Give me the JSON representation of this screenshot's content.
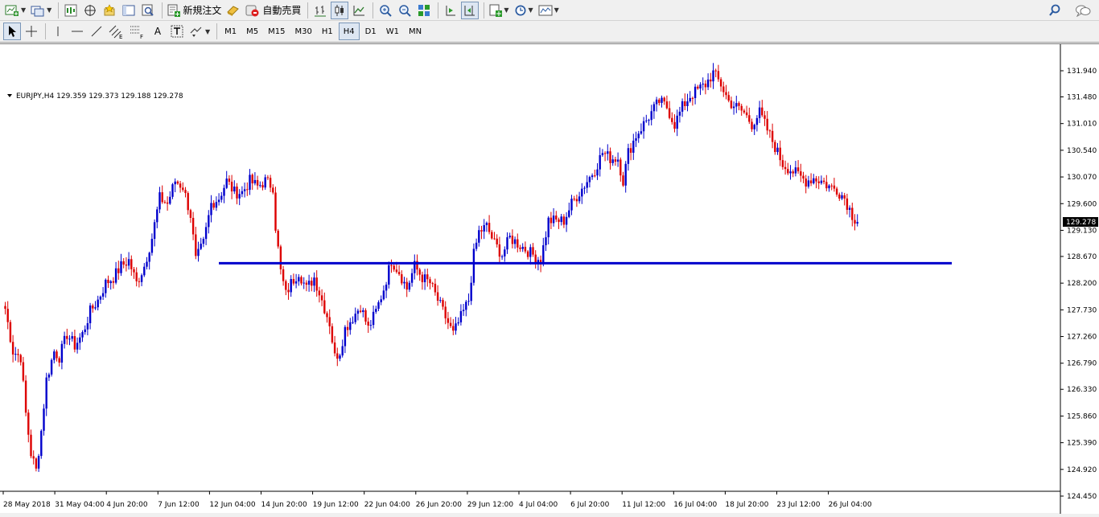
{
  "toolbar_main": {
    "new_order_label": "新規注文",
    "auto_trade_label": "自動売買",
    "icons": [
      "new-chart-icon",
      "profiles-icon",
      "market-watch-icon",
      "navigator-icon",
      "favorites-icon",
      "data-window-icon",
      "strategy-tester-icon",
      "new-order-icon",
      "metaeditor-icon",
      "autotrading-icon",
      "bar-chart-icon",
      "candlestick-icon",
      "line-chart-icon",
      "zoom-in-icon",
      "zoom-out-icon",
      "tile-windows-icon",
      "autoscroll-icon",
      "chart-shift-icon",
      "indicators-icon",
      "periods-icon",
      "templates-icon",
      "search-icon",
      "chat-icon"
    ]
  },
  "toolbar_draw": {
    "fib_e_label": "E",
    "fib_f_label": "F",
    "text_label": "A",
    "timeframes": [
      "M1",
      "M5",
      "M15",
      "M30",
      "H1",
      "H4",
      "D1",
      "W1",
      "MN"
    ],
    "active_timeframe": "H4"
  },
  "chart": {
    "header": "EURJPY,H4  129.359 129.373 129.188 129.278",
    "current_price": "129.278",
    "price_labels": [
      "131.940",
      "131.480",
      "131.010",
      "130.540",
      "130.070",
      "129.600",
      "129.130",
      "128.670",
      "128.200",
      "127.730",
      "127.260",
      "126.790",
      "126.330",
      "125.860",
      "125.390",
      "124.920",
      "124.450"
    ],
    "time_labels": [
      "28 May 2018",
      "31 May 04:00",
      "4 Jun 20:00",
      "7 Jun 12:00",
      "12 Jun 04:00",
      "14 Jun 20:00",
      "19 Jun 12:00",
      "22 Jun 04:00",
      "26 Jun 20:00",
      "29 Jun 12:00",
      "4 Jul 04:00",
      "6 Jul 20:00",
      "11 Jul 12:00",
      "16 Jul 04:00",
      "18 Jul 20:00",
      "23 Jul 12:00",
      "26 Jul 04:00"
    ],
    "horizontal_line_price": 128.55,
    "colors": {
      "bull": "#0000cc",
      "bear": "#dd0000",
      "hline": "#0000cc",
      "background": "#ffffff"
    }
  },
  "chart_data": {
    "type": "candlestick",
    "symbol": "EURJPY",
    "timeframe": "H4",
    "ylim": [
      124.45,
      131.94
    ],
    "anchors": [
      [
        0,
        127.75
      ],
      [
        3,
        127.0
      ],
      [
        6,
        126.9
      ],
      [
        8,
        125.9
      ],
      [
        10,
        125.2
      ],
      [
        12,
        124.9
      ],
      [
        14,
        125.6
      ],
      [
        16,
        126.5
      ],
      [
        19,
        127.0
      ],
      [
        21,
        126.9
      ],
      [
        24,
        127.3
      ],
      [
        27,
        127.1
      ],
      [
        30,
        127.3
      ],
      [
        33,
        127.7
      ],
      [
        36,
        127.9
      ],
      [
        39,
        128.2
      ],
      [
        42,
        128.3
      ],
      [
        45,
        128.5
      ],
      [
        48,
        128.6
      ],
      [
        51,
        128.2
      ],
      [
        54,
        128.5
      ],
      [
        57,
        129.0
      ],
      [
        60,
        129.7
      ],
      [
        63,
        129.6
      ],
      [
        66,
        130.0
      ],
      [
        69,
        129.9
      ],
      [
        72,
        129.4
      ],
      [
        74,
        128.6
      ],
      [
        77,
        128.9
      ],
      [
        80,
        129.6
      ],
      [
        83,
        129.7
      ],
      [
        86,
        130.0
      ],
      [
        89,
        129.8
      ],
      [
        92,
        129.8
      ],
      [
        95,
        130.0
      ],
      [
        98,
        129.9
      ],
      [
        101,
        130.0
      ],
      [
        104,
        129.9
      ],
      [
        105,
        129.2
      ],
      [
        107,
        128.4
      ],
      [
        109,
        128.0
      ],
      [
        111,
        128.2
      ],
      [
        114,
        128.4
      ],
      [
        117,
        128.1
      ],
      [
        120,
        128.3
      ],
      [
        123,
        127.9
      ],
      [
        126,
        127.5
      ],
      [
        128,
        126.9
      ],
      [
        130,
        127.0
      ],
      [
        132,
        127.4
      ],
      [
        135,
        127.6
      ],
      [
        138,
        127.8
      ],
      [
        141,
        127.4
      ],
      [
        144,
        127.7
      ],
      [
        147,
        128.1
      ],
      [
        150,
        128.6
      ],
      [
        153,
        128.4
      ],
      [
        156,
        128.1
      ],
      [
        159,
        128.5
      ],
      [
        162,
        128.3
      ],
      [
        165,
        128.2
      ],
      [
        168,
        127.9
      ],
      [
        171,
        127.6
      ],
      [
        174,
        127.3
      ],
      [
        177,
        127.6
      ],
      [
        180,
        127.9
      ],
      [
        182,
        128.7
      ],
      [
        184,
        129.1
      ],
      [
        187,
        129.2
      ],
      [
        190,
        128.9
      ],
      [
        193,
        128.7
      ],
      [
        196,
        129.0
      ],
      [
        199,
        128.9
      ],
      [
        202,
        128.8
      ],
      [
        205,
        128.7
      ],
      [
        208,
        128.6
      ],
      [
        211,
        129.3
      ],
      [
        214,
        129.3
      ],
      [
        217,
        129.3
      ],
      [
        220,
        129.6
      ],
      [
        223,
        129.8
      ],
      [
        226,
        130.0
      ],
      [
        229,
        130.2
      ],
      [
        232,
        130.5
      ],
      [
        235,
        130.4
      ],
      [
        238,
        130.4
      ],
      [
        240,
        130.0
      ],
      [
        242,
        130.5
      ],
      [
        245,
        130.8
      ],
      [
        248,
        131.0
      ],
      [
        251,
        131.2
      ],
      [
        254,
        131.4
      ],
      [
        257,
        131.3
      ],
      [
        260,
        131.0
      ],
      [
        263,
        131.3
      ],
      [
        266,
        131.5
      ],
      [
        269,
        131.6
      ],
      [
        272,
        131.7
      ],
      [
        275,
        131.9
      ],
      [
        278,
        131.7
      ],
      [
        281,
        131.4
      ],
      [
        284,
        131.3
      ],
      [
        287,
        131.2
      ],
      [
        290,
        131.0
      ],
      [
        293,
        131.2
      ],
      [
        296,
        130.9
      ],
      [
        299,
        130.6
      ],
      [
        302,
        130.3
      ],
      [
        305,
        130.2
      ],
      [
        308,
        130.1
      ],
      [
        311,
        130.0
      ],
      [
        314,
        130.05
      ],
      [
        317,
        130.0
      ],
      [
        320,
        129.9
      ],
      [
        323,
        129.85
      ],
      [
        326,
        129.7
      ],
      [
        329,
        129.4
      ],
      [
        331,
        129.278
      ]
    ]
  }
}
